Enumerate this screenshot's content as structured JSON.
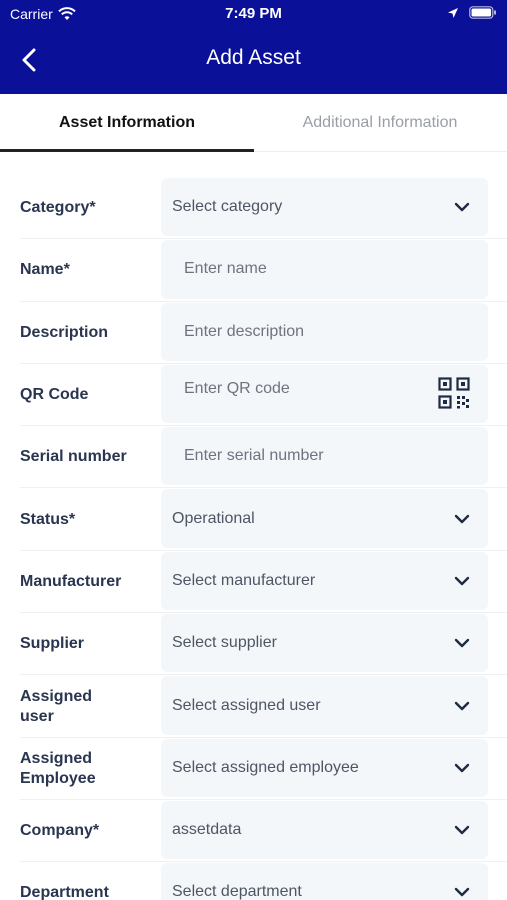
{
  "status_bar": {
    "carrier": "Carrier",
    "time": "7:49 PM"
  },
  "nav": {
    "title": "Add Asset",
    "back_icon": "chevron-left-icon"
  },
  "tabs": [
    {
      "label": "Asset Information",
      "active": true
    },
    {
      "label": "Additional Information",
      "active": false
    }
  ],
  "form": {
    "rows": [
      {
        "label": "Category*",
        "type": "select",
        "value": "Select category"
      },
      {
        "label": "Name*",
        "type": "input",
        "placeholder": "Enter name"
      },
      {
        "label": "Description",
        "type": "input",
        "placeholder": "Enter description"
      },
      {
        "label": "QR Code",
        "type": "qr",
        "placeholder": "Enter QR code"
      },
      {
        "label": "Serial number",
        "type": "input",
        "placeholder": "Enter serial number"
      },
      {
        "label": "Status*",
        "type": "select",
        "value": "Operational"
      },
      {
        "label": "Manufacturer",
        "type": "select",
        "value": "Select manufacturer"
      },
      {
        "label": "Supplier",
        "type": "select",
        "value": "Select supplier"
      },
      {
        "label": "Assigned user",
        "type": "select",
        "value": "Select assigned user"
      },
      {
        "label": "Assigned Employee",
        "type": "select",
        "value": "Select assigned employee"
      },
      {
        "label": "Company*",
        "type": "select",
        "value": "assetdata"
      },
      {
        "label": "Department",
        "type": "select",
        "value": "Select department"
      }
    ]
  },
  "colors": {
    "header": "#0a1098",
    "field_bg": "#f4f7f9",
    "label": "#2a3550"
  }
}
